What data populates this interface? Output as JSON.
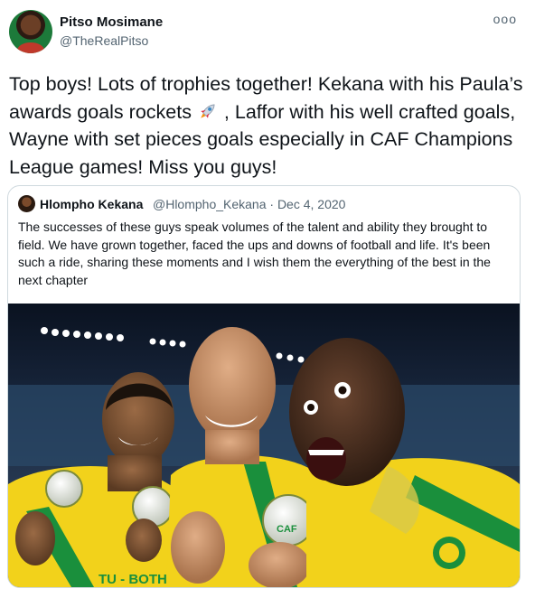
{
  "author": {
    "name": "Pitso Mosimane",
    "handle": "@TheRealPitso"
  },
  "more_glyph": "ooo",
  "tweet_parts": [
    "Top boys! Lots of trophies together! Kekana with his Paula’s awards goals rockets ",
    " , Laffor with his well crafted goals, Wayne with set pieces goals especially in CAF Champions League games! Miss you guys!"
  ],
  "quoted": {
    "name": "Hlompho Kekana",
    "meta": "@Hlompho_Kekana · Dec 4, 2020",
    "text": "The successes of these guys speak volumes of the talent and ability they brought to field. We have grown together, faced the ups and downs of football and life. It's been such a ride, sharing these moments and I wish them the everything of the best in the next chapter",
    "photo": {
      "kit_colors": {
        "yellow": "#f2d21b",
        "green": "#1a8f3c"
      },
      "medal_text": "CAF",
      "shirt_text": "TU - BOTHO"
    }
  }
}
